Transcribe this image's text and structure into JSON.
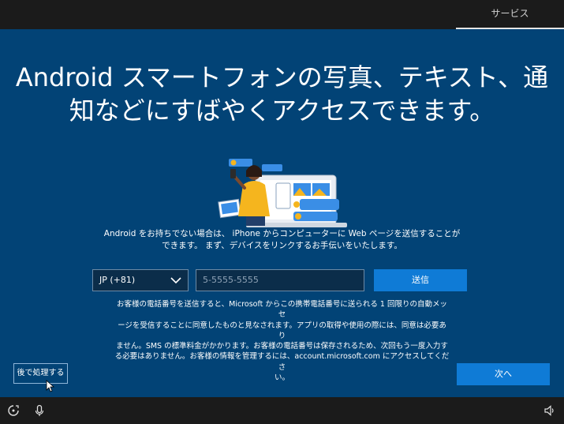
{
  "header": {
    "tab_label": "サービス"
  },
  "main": {
    "headline_line1": "Android スマートフォンの写真、テキスト、通",
    "headline_line2": "知などにすばやくアクセスできます。",
    "description_line1": "Android をお持ちでない場合は、 iPhone からコンピューターに Web ページを送信することが",
    "description_line2": "できます。 まず、デバイスをリンクするお手伝いをいたします。",
    "country_select_value": "JP (+81)",
    "phone_placeholder": "5-5555-5555",
    "send_label": "送信",
    "legal_lines": [
      "お客様の電話番号を送信すると、Microsoft からこの携帯電話番号に送られる 1 回限りの自動メッセ",
      "ージを受信することに同意したものと見なされます。アプリの取得や使用の際には、同意は必要あり",
      "ません。SMS の標準料金がかかります。お客様の電話番号は保存されるため、次回もう一度入力す",
      "る必要はありません。お客様の情報を管理するには、account.microsoft.com にアクセスしてくださ",
      "い。"
    ],
    "later_label": "後で処理する",
    "next_label": "次へ"
  },
  "taskbar": {
    "icons": [
      "ease-of-access-icon",
      "microphone-icon",
      "volume-icon"
    ]
  },
  "colors": {
    "background": "#024376",
    "accent_button": "#0f7bd6",
    "bar": "#1b1b1b",
    "illustration_yellow": "#f5b51e",
    "illustration_blue": "#3a8ee6"
  }
}
